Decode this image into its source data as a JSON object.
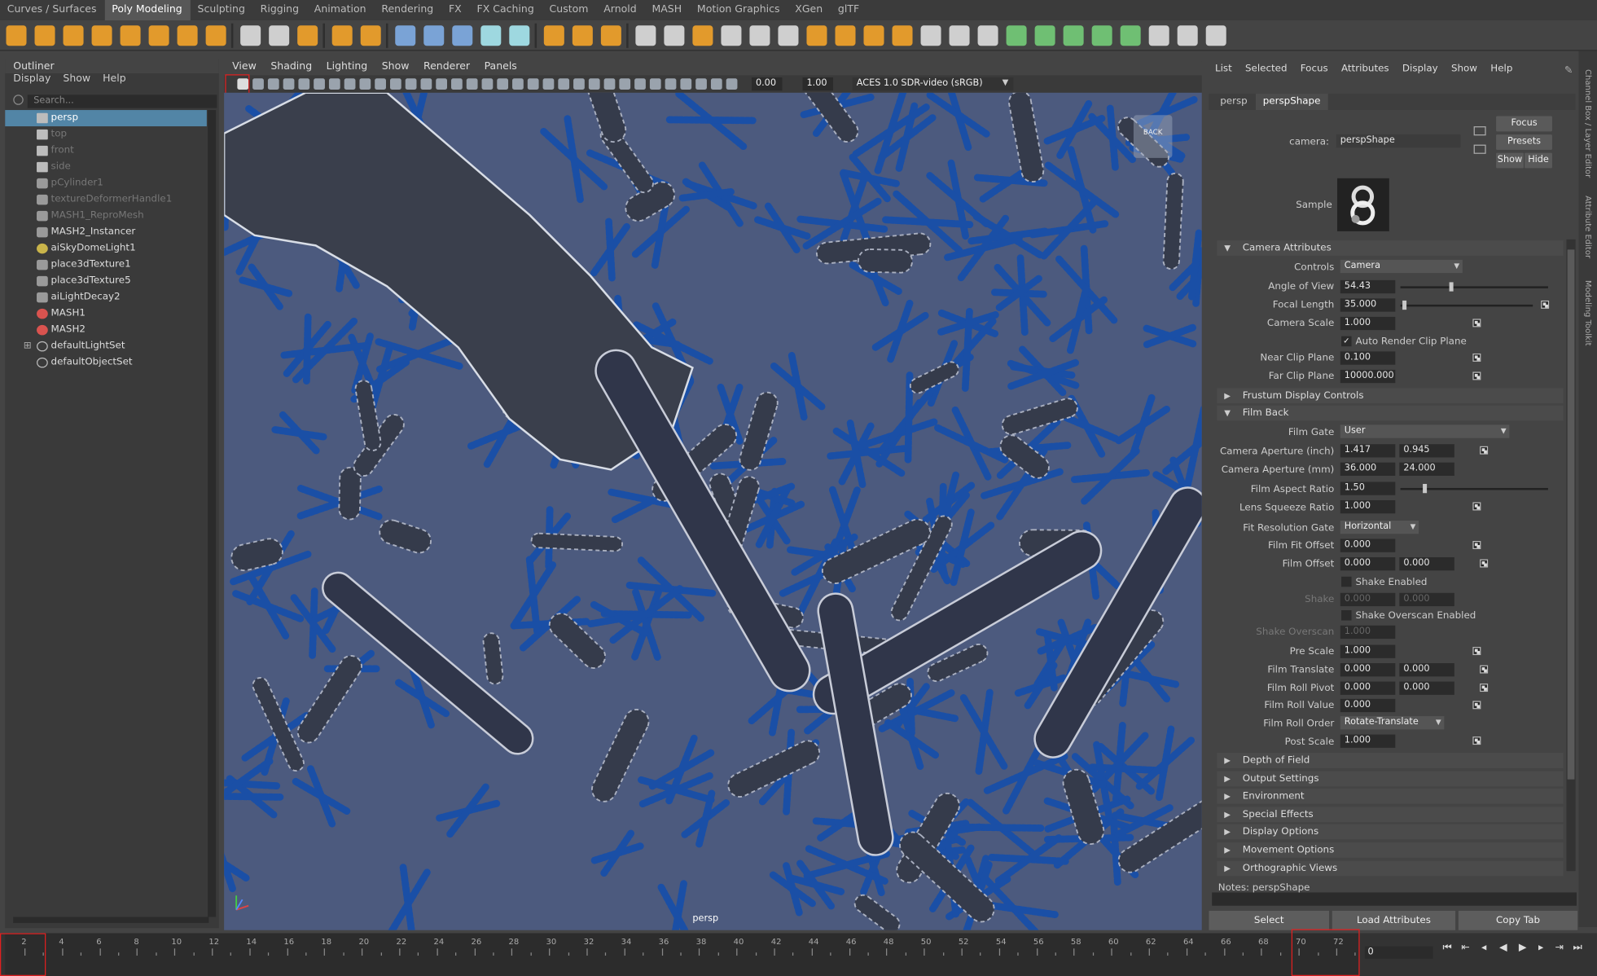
{
  "shelf_tabs": [
    "Curves / Surfaces",
    "Poly Modeling",
    "Sculpting",
    "Rigging",
    "Animation",
    "Rendering",
    "FX",
    "FX Caching",
    "Custom",
    "Arnold",
    "MASH",
    "Motion Graphics",
    "XGen",
    "glTF"
  ],
  "shelf_active": "Poly Modeling",
  "outliner": {
    "title": "Outliner",
    "menu": [
      "Display",
      "Show",
      "Help"
    ],
    "search_placeholder": "Search...",
    "items": [
      {
        "label": "persp",
        "icon": "camera-icon",
        "state": "selected"
      },
      {
        "label": "top",
        "icon": "camera-icon",
        "state": "dim"
      },
      {
        "label": "front",
        "icon": "camera-icon",
        "state": "dim"
      },
      {
        "label": "side",
        "icon": "camera-icon",
        "state": "dim"
      },
      {
        "label": "pCylinder1",
        "icon": "mesh-icon",
        "state": "dim"
      },
      {
        "label": "textureDeformerHandle1",
        "icon": "deformer-icon",
        "state": "dim"
      },
      {
        "label": "MASH1_ReproMesh",
        "icon": "mesh-icon",
        "state": "dim"
      },
      {
        "label": "MASH2_Instancer",
        "icon": "instancer-icon",
        "state": "normal"
      },
      {
        "label": "aiSkyDomeLight1",
        "icon": "light-icon",
        "state": "normal"
      },
      {
        "label": "place3dTexture1",
        "icon": "texture-placement-icon",
        "state": "normal"
      },
      {
        "label": "place3dTexture5",
        "icon": "texture-placement-icon",
        "state": "normal"
      },
      {
        "label": "aiLightDecay2",
        "icon": "light-decay-icon",
        "state": "normal"
      },
      {
        "label": "MASH1",
        "icon": "mash-icon",
        "state": "normal"
      },
      {
        "label": "MASH2",
        "icon": "mash-icon",
        "state": "normal"
      },
      {
        "label": "defaultLightSet",
        "icon": "set-icon",
        "state": "normal"
      },
      {
        "label": "defaultObjectSet",
        "icon": "set-icon",
        "state": "normal"
      }
    ]
  },
  "viewport": {
    "menu": [
      "View",
      "Shading",
      "Lighting",
      "Show",
      "Renderer",
      "Panels"
    ],
    "exposure": "0.00",
    "gamma": "1.00",
    "color_space": "ACES 1.0 SDR-video (sRGB)",
    "camera_label": "persp",
    "cube_label": "BACK"
  },
  "attribute_editor": {
    "menu": [
      "List",
      "Selected",
      "Focus",
      "Attributes",
      "Display",
      "Show",
      "Help"
    ],
    "tabs": [
      "persp",
      "perspShape"
    ],
    "camera_label": "camera:",
    "camera_value": "perspShape",
    "buttons": {
      "focus": "Focus",
      "presets": "Presets",
      "show": "Show",
      "hide": "Hide"
    },
    "sample_label": "Sample",
    "sections": {
      "camera_attributes": "Camera Attributes",
      "frustum": "Frustum Display Controls",
      "film_back": "Film Back",
      "collapsed": [
        "Depth of Field",
        "Output Settings",
        "Environment",
        "Special Effects",
        "Display Options",
        "Movement Options",
        "Orthographic Views"
      ]
    },
    "camera": {
      "controls_label": "Controls",
      "controls_value": "Camera",
      "aov_label": "Angle of View",
      "aov": "54.43",
      "focal_label": "Focal Length",
      "focal": "35.000",
      "scale_label": "Camera Scale",
      "scale": "1.000",
      "auto_clip_label": "Auto Render Clip Plane",
      "near_label": "Near Clip Plane",
      "near": "0.100",
      "far_label": "Far Clip Plane",
      "far": "10000.000"
    },
    "film": {
      "gate_label": "Film Gate",
      "gate": "User",
      "ap_inch_label": "Camera Aperture (inch)",
      "ap_inch": [
        "1.417",
        "0.945"
      ],
      "ap_mm_label": "Camera Aperture (mm)",
      "ap_mm": [
        "36.000",
        "24.000"
      ],
      "aspect_label": "Film Aspect Ratio",
      "aspect": "1.50",
      "squeeze_label": "Lens Squeeze Ratio",
      "squeeze": "1.000",
      "fit_label": "Fit Resolution Gate",
      "fit": "Horizontal",
      "fit_offset_label": "Film Fit Offset",
      "fit_offset": "0.000",
      "offset_label": "Film Offset",
      "offset": [
        "0.000",
        "0.000"
      ],
      "shake_en_label": "Shake Enabled",
      "shake_label": "Shake",
      "shake": [
        "0.000",
        "0.000"
      ],
      "shake_os_en_label": "Shake Overscan Enabled",
      "shake_os_label": "Shake Overscan",
      "shake_os": "1.000",
      "pre_scale_label": "Pre Scale",
      "pre_scale": "1.000",
      "translate_label": "Film Translate",
      "translate": [
        "0.000",
        "0.000"
      ],
      "pivot_label": "Film Roll Pivot",
      "pivot": [
        "0.000",
        "0.000"
      ],
      "roll_value_label": "Film Roll Value",
      "roll_value": "0.000",
      "roll_order_label": "Film Roll Order",
      "roll_order": "Rotate-Translate",
      "post_scale_label": "Post Scale",
      "post_scale": "1.000"
    },
    "notes_label": "Notes:  perspShape",
    "bottom_buttons": [
      "Select",
      "Load Attributes",
      "Copy Tab"
    ]
  },
  "side_strip": [
    "Channel Box / Layer Editor",
    "Attribute Editor",
    "Modeling Toolkit"
  ],
  "timeline": {
    "ticks": [
      "2",
      "4",
      "6",
      "8",
      "10",
      "12",
      "14",
      "16",
      "18",
      "20",
      "22",
      "24",
      "26",
      "28",
      "30",
      "32",
      "34",
      "36",
      "38",
      "40",
      "42",
      "44",
      "46",
      "48",
      "50",
      "52",
      "54",
      "56",
      "58",
      "60",
      "62",
      "64",
      "66",
      "68",
      "70",
      "72"
    ],
    "current_frame": "0"
  }
}
